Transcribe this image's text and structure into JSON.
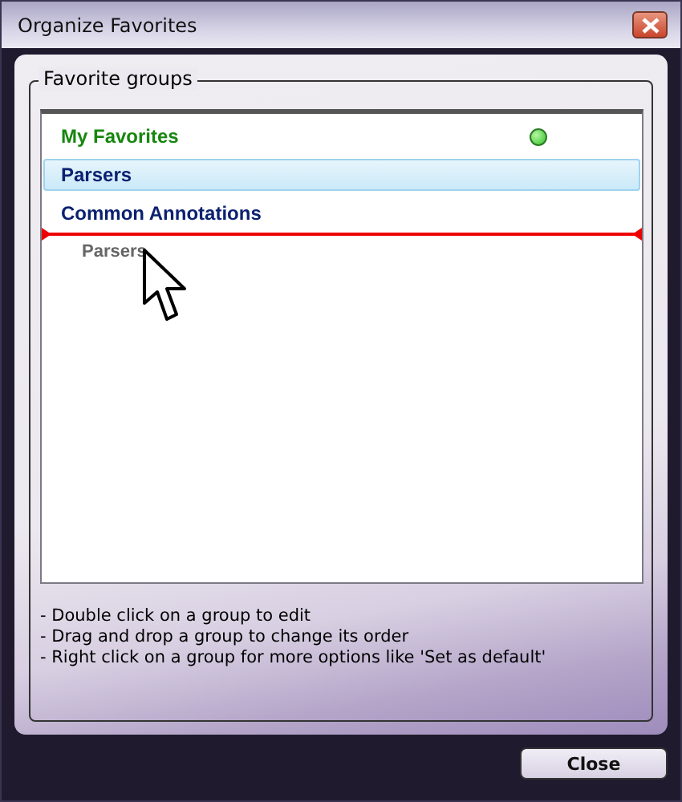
{
  "window": {
    "title": "Organize Favorites"
  },
  "group_box": {
    "title": "Favorite groups"
  },
  "groups": [
    {
      "label": "My Favorites",
      "selected": false,
      "default": true
    },
    {
      "label": "Parsers",
      "selected": true,
      "default": false
    },
    {
      "label": "Common Annotations",
      "selected": false,
      "default": false
    }
  ],
  "drag": {
    "label": "Parsers"
  },
  "instructions": [
    "- Double click on a group to edit",
    "- Drag and drop a group to change its order",
    "- Right click on a group for more options like 'Set as default'"
  ],
  "buttons": [
    "Close"
  ]
}
